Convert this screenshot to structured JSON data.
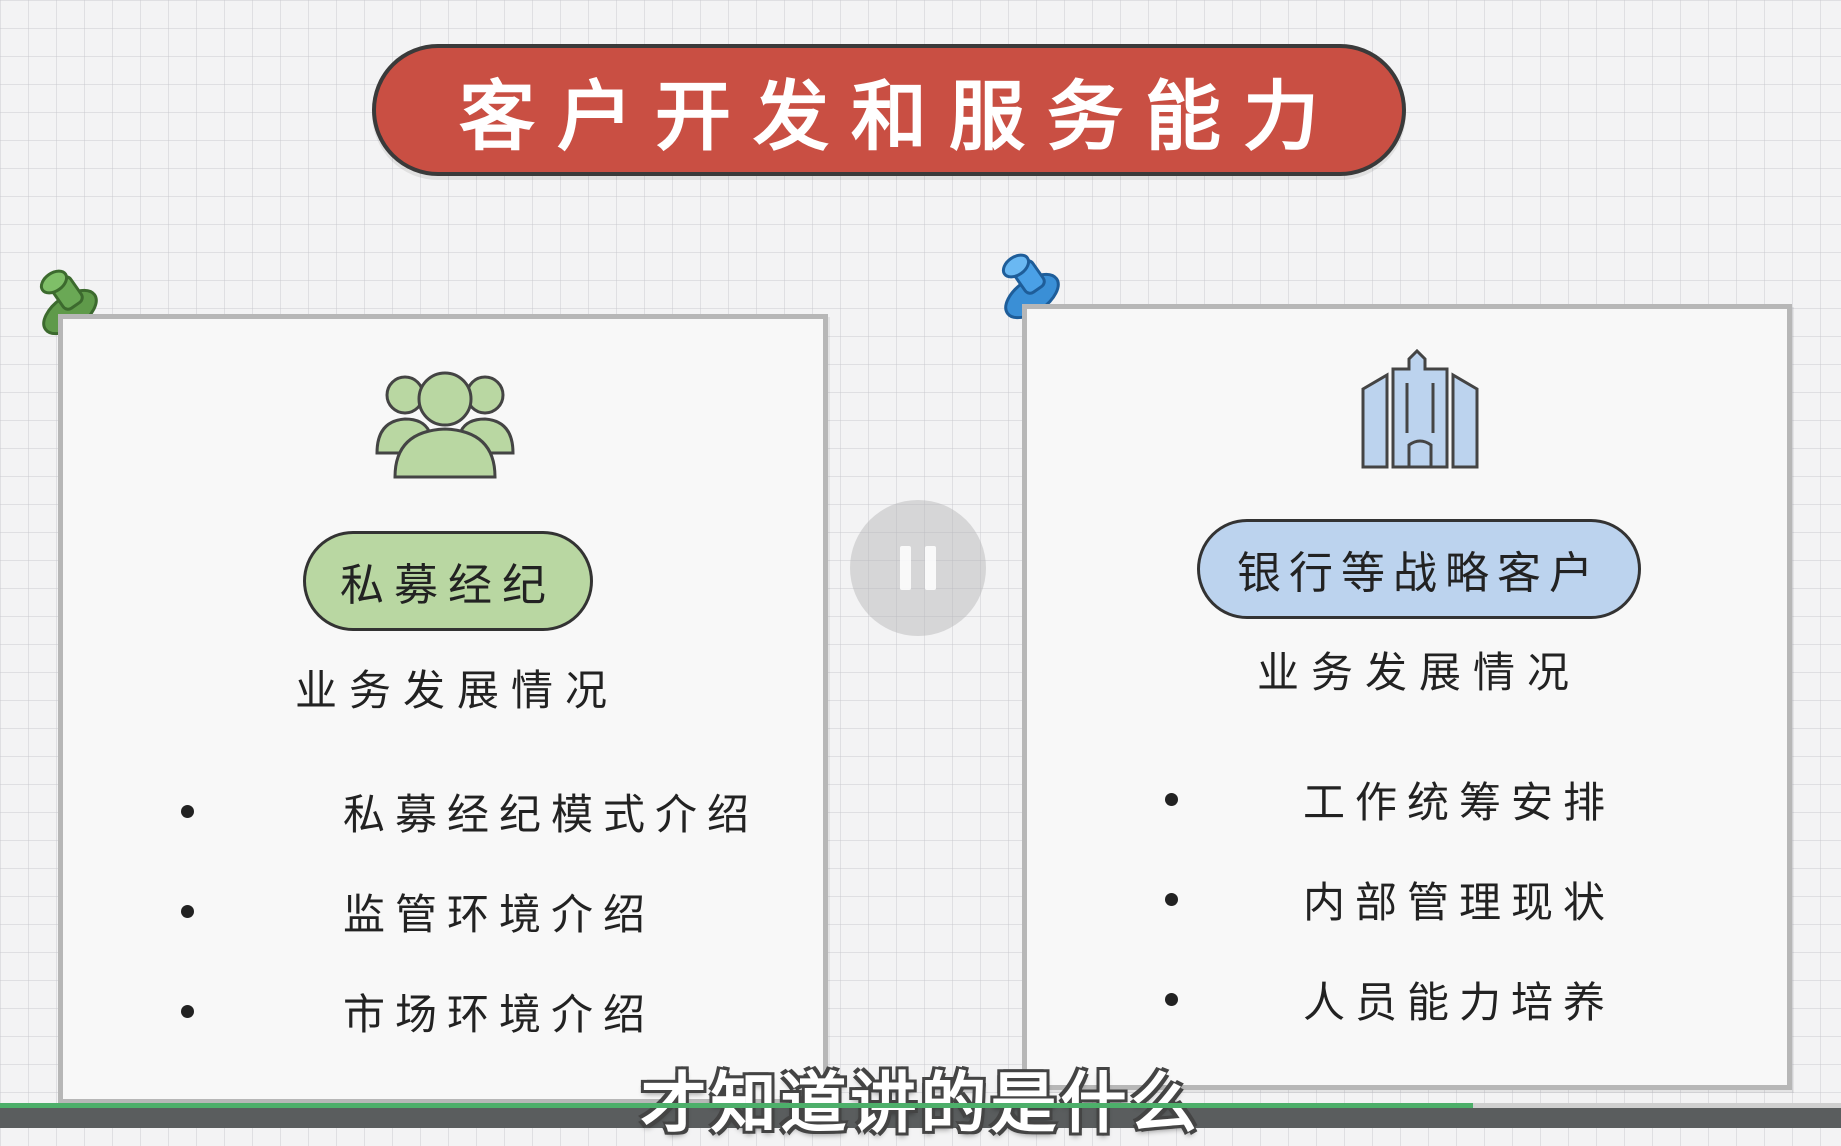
{
  "title": "客户开发和服务能力",
  "left_card": {
    "icon": "people-group-icon",
    "pill_label": "私募经纪",
    "subtitle": "业务发展情况",
    "bullets": [
      "私募经纪模式介绍",
      "监管环境介绍",
      "市场环境介绍"
    ],
    "pin_color": "#5f9a4a",
    "pill_color": "#b9d7a2"
  },
  "right_card": {
    "icon": "office-building-icon",
    "pill_label": "银行等战略客户",
    "subtitle": "业务发展情况",
    "bullets": [
      "工作统筹安排",
      "内部管理现状",
      "人员能力培养"
    ],
    "pin_color": "#3a8fd6",
    "pill_color": "#bcd3ee"
  },
  "player": {
    "pause_icon": "pause-icon",
    "subtitle_caption": "才知道讲的是什么",
    "progress": 0.8
  },
  "colors": {
    "title_banner": "#c94f43",
    "progress_fill": "#4daf6a"
  }
}
